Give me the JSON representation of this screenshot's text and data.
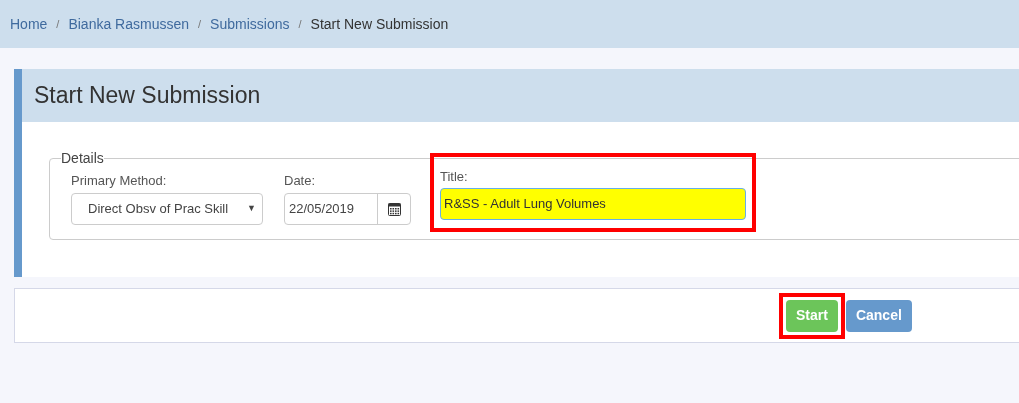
{
  "breadcrumb": [
    {
      "label": "Home",
      "current": false
    },
    {
      "label": "Bianka Rasmussen",
      "current": false
    },
    {
      "label": "Submissions",
      "current": false
    },
    {
      "label": "Start New Submission",
      "current": true
    }
  ],
  "breadcrumb_separator": "/",
  "panel": {
    "title": "Start New Submission"
  },
  "details": {
    "legend": "Details",
    "primary_method": {
      "label": "Primary Method:",
      "value": "Direct Obsv of Prac Skill",
      "caret": "▼"
    },
    "date": {
      "label": "Date:",
      "value": "22/05/2019"
    },
    "title": {
      "label": "Title:",
      "value": "R&SS - Adult Lung Volumes",
      "highlighted": true
    }
  },
  "buttons": [
    {
      "label": "Start",
      "kind": "primary",
      "highlighted": true
    },
    {
      "label": "Cancel",
      "kind": "secondary",
      "highlighted": false
    }
  ]
}
